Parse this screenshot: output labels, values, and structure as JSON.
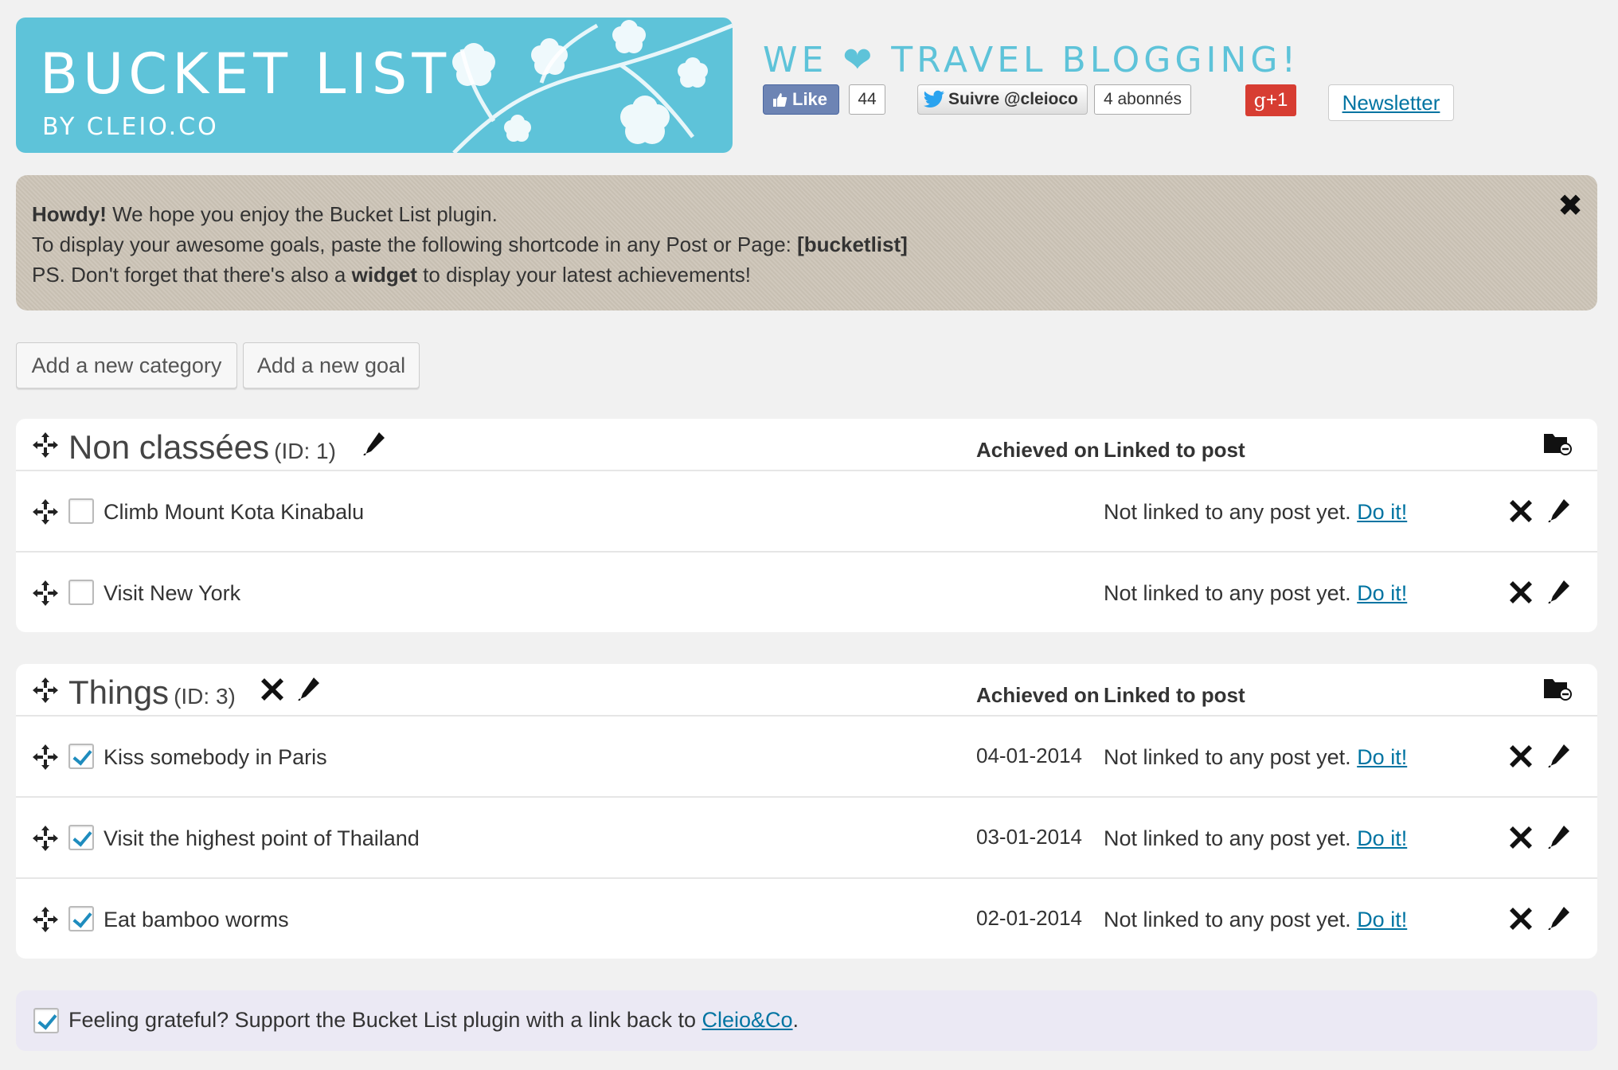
{
  "banner": {
    "title": "BUCKET LIST",
    "subtitle": "BY CLEIO.CO"
  },
  "header": {
    "tagline_before": "WE",
    "tagline_heart": "❤",
    "tagline_after": "TRAVEL BLOGGING!",
    "fb_like_label": "Like",
    "fb_like_count": "44",
    "twitter_follow_label": "Suivre @cleioco",
    "twitter_followers": "4 abonnés",
    "gplus_label": "+1",
    "newsletter_label": "Newsletter"
  },
  "notice": {
    "line1_bold": "Howdy!",
    "line1_rest": " We hope you enjoy the Bucket List plugin.",
    "line2_text": "To display your awesome goals, paste the following shortcode in any Post or Page: ",
    "line2_code": "[bucketlist]",
    "line3_before": "PS. Don't forget that there's also a ",
    "line3_bold": "widget",
    "line3_after": " to display your latest achievements!",
    "close_glyph": "✖"
  },
  "actions": {
    "add_category": "Add a new category",
    "add_goal": "Add a new goal"
  },
  "columns": {
    "achieved_on": "Achieved on",
    "linked_to_post": "Linked to post"
  },
  "categories": [
    {
      "name": "Non classées",
      "id_label": "(ID: 1)",
      "goals": [
        {
          "title": "Climb Mount Kota Kinabalu",
          "checked": false,
          "date": "",
          "linked": "Not linked to any post yet.",
          "link_label": "Do it!"
        },
        {
          "title": "Visit New York",
          "checked": false,
          "date": "",
          "linked": "Not linked to any post yet.",
          "link_label": "Do it!"
        }
      ]
    },
    {
      "name": "Things",
      "id_label": "(ID: 3)",
      "goals": [
        {
          "title": "Kiss somebody in Paris",
          "checked": true,
          "date": "04-01-2014",
          "linked": "Not linked to any post yet.",
          "link_label": "Do it!"
        },
        {
          "title": "Visit the highest point of Thailand",
          "checked": true,
          "date": "03-01-2014",
          "linked": "Not linked to any post yet.",
          "link_label": "Do it!"
        },
        {
          "title": "Eat bamboo worms",
          "checked": true,
          "date": "02-01-2014",
          "linked": "Not linked to any post yet.",
          "link_label": "Do it!"
        }
      ]
    }
  ],
  "footer": {
    "checked": true,
    "text": "Feeling grateful? Support the Bucket List plugin with a link back to ",
    "link_label": "Cleio&Co",
    "suffix": "."
  },
  "colors": {
    "brand": "#5ec3d9",
    "link": "#0074a2",
    "notice_bg": "#cdc5b8",
    "checkmark": "#1e8cbe"
  }
}
